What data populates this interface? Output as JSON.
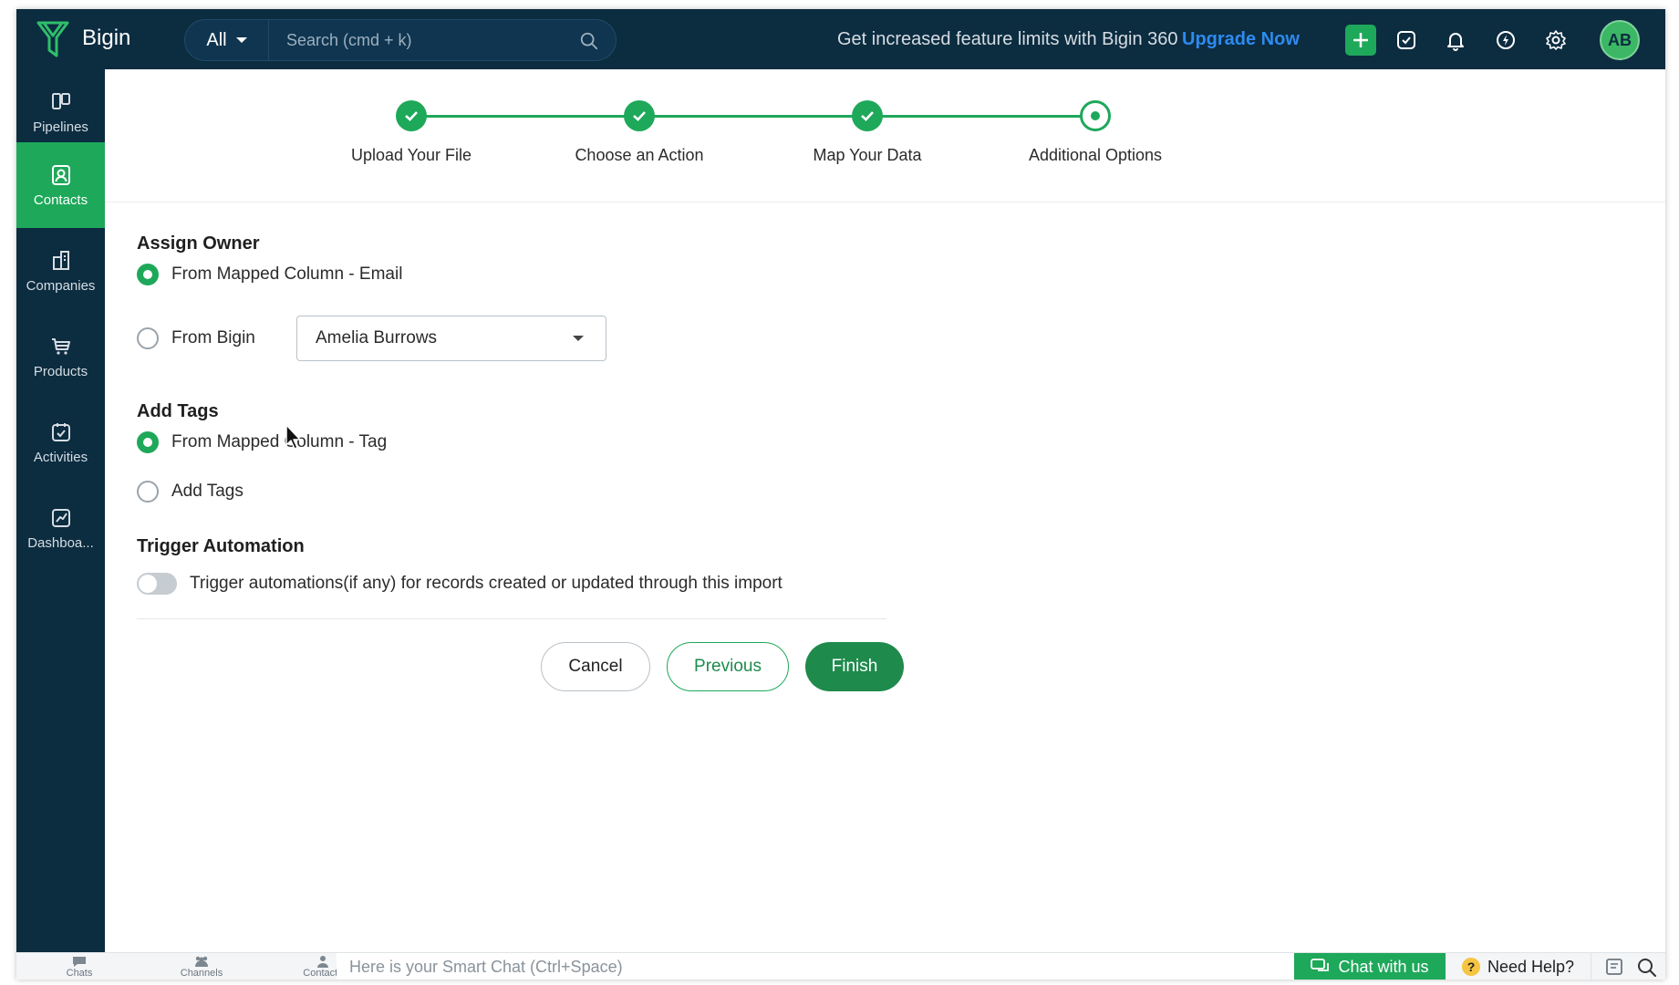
{
  "app": {
    "brand": "Bigin"
  },
  "topbar": {
    "search_scope": "All",
    "search_placeholder": "Search (cmd + k)",
    "promo_text": "Get increased feature limits with Bigin 360",
    "upgrade_label": "Upgrade Now",
    "avatar_initials": "AB"
  },
  "sidebar": {
    "items": [
      {
        "label": "Pipelines",
        "icon": "pipelines-icon"
      },
      {
        "label": "Contacts",
        "icon": "contacts-icon",
        "active": true
      },
      {
        "label": "Companies",
        "icon": "companies-icon"
      },
      {
        "label": "Products",
        "icon": "products-icon"
      },
      {
        "label": "Activities",
        "icon": "activities-icon"
      },
      {
        "label": "Dashboa...",
        "icon": "dashboards-icon"
      }
    ]
  },
  "stepper": {
    "steps": [
      {
        "label": "Upload Your File",
        "state": "done"
      },
      {
        "label": "Choose an Action",
        "state": "done"
      },
      {
        "label": "Map Your Data",
        "state": "done"
      },
      {
        "label": "Additional Options",
        "state": "current"
      }
    ]
  },
  "assign_owner": {
    "title": "Assign Owner",
    "option_mapped": "From Mapped Column - Email",
    "option_bigin": "From Bigin",
    "owner_selected": "Amelia Burrows"
  },
  "add_tags": {
    "title": "Add Tags",
    "option_mapped": "From Mapped Column - Tag",
    "option_add": "Add Tags"
  },
  "trigger_automation": {
    "title": "Trigger Automation",
    "toggle_label": "Trigger automations(if any) for records created or updated through this import",
    "enabled": false
  },
  "actions": {
    "cancel": "Cancel",
    "previous": "Previous",
    "finish": "Finish"
  },
  "bottombar": {
    "chats": "Chats",
    "channels": "Channels",
    "contacts": "Contacts",
    "smartchat_placeholder": "Here is your Smart Chat (Ctrl+Space)",
    "chat_with_us": "Chat with us",
    "need_help": "Need Help?"
  },
  "colors": {
    "nav_bg": "#0c2c40",
    "accent_green": "#1ea85a",
    "link_blue": "#2d8bf0"
  }
}
